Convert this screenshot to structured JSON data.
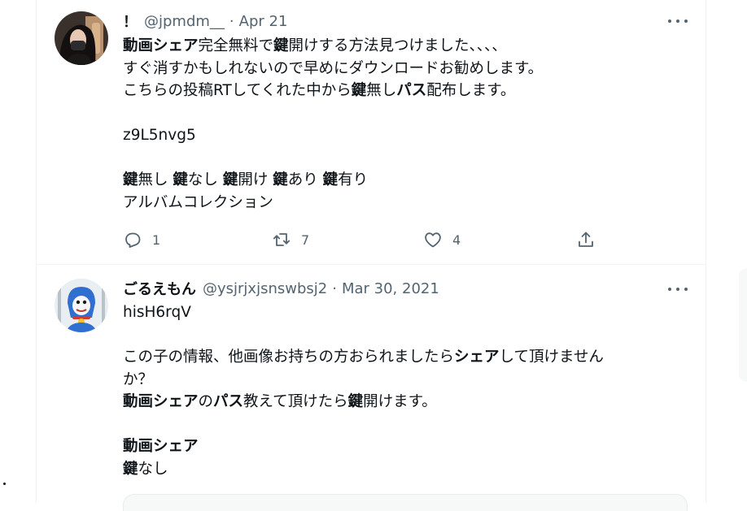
{
  "tweets": [
    {
      "display_name": "！",
      "handle": "@jpmdm__",
      "separator": "·",
      "date": "Apr 21",
      "body_lines": [
        [
          {
            "t": "動画シェア",
            "b": true
          },
          {
            "t": "完全無料で"
          },
          {
            "t": "鍵",
            "b": true
          },
          {
            "t": "開けする方法見つけました、、、、"
          }
        ],
        [
          {
            "t": "すぐ消すかもしれないので早めにダウンロードお勧めします。"
          }
        ],
        [
          {
            "t": "こちらの投稿RTしてくれた中から"
          },
          {
            "t": "鍵",
            "b": true
          },
          {
            "t": "無し"
          },
          {
            "t": "パス",
            "b": true
          },
          {
            "t": "配布します。"
          }
        ],
        [],
        [
          {
            "t": "z9L5nvg5"
          }
        ],
        [],
        [
          {
            "t": "鍵",
            "b": true
          },
          {
            "t": "無し "
          },
          {
            "t": "鍵",
            "b": true
          },
          {
            "t": "なし "
          },
          {
            "t": "鍵",
            "b": true
          },
          {
            "t": "開け "
          },
          {
            "t": "鍵",
            "b": true
          },
          {
            "t": "あり "
          },
          {
            "t": "鍵",
            "b": true
          },
          {
            "t": "有り"
          }
        ],
        [
          {
            "t": "アルバムコレクション"
          }
        ]
      ],
      "reply_count": "1",
      "retweet_count": "7",
      "like_count": "4"
    },
    {
      "display_name": "ごるえもん",
      "handle": "@ysjrjxjsnswbsj2",
      "separator": "·",
      "date": "Mar 30, 2021",
      "body_lines": [
        [
          {
            "t": "hisH6rqV"
          }
        ],
        [],
        [
          {
            "t": "この子の情報、他画像お持ちの方おられましたら"
          },
          {
            "t": "シェア",
            "b": true
          },
          {
            "t": "して頂けません"
          }
        ],
        [
          {
            "t": "か？"
          }
        ],
        [
          {
            "t": "動画シェア",
            "b": true
          },
          {
            "t": "の"
          },
          {
            "t": "パス",
            "b": true
          },
          {
            "t": "教えて頂けたら"
          },
          {
            "t": "鍵",
            "b": true
          },
          {
            "t": "開けます。"
          }
        ],
        [],
        [
          {
            "t": "動画シェア",
            "b": true
          }
        ],
        [
          {
            "t": "鍵",
            "b": true
          },
          {
            "t": "なし"
          }
        ]
      ]
    }
  ],
  "icons": {
    "more": "more-horizontal-icon",
    "reply": "reply-icon",
    "retweet": "retweet-icon",
    "like": "heart-icon",
    "share": "share-icon"
  },
  "colors": {
    "text": "#0f1419",
    "muted": "#536471",
    "border": "#eff3f4"
  }
}
